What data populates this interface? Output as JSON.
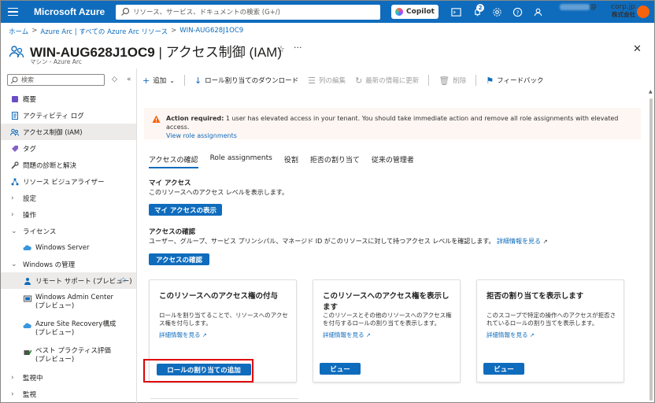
{
  "app": {
    "brand": "Microsoft Azure",
    "search_placeholder": "リソース、サービス、ドキュメントの検索 (G+/)",
    "copilot_label": "Copilot",
    "notification_count": "2",
    "account_email_suffix": "@　　corp.jp",
    "account_org": "株式会社"
  },
  "breadcrumb": [
    "ホーム",
    "Azure Arc | すべての Azure Arc リソース",
    "WIN-AUG628J1OC9"
  ],
  "header": {
    "resource_name": "WIN-AUG628J1OC9",
    "page_name": " | アクセス制御 (IAM)",
    "subtitle": "マシン - Azure Arc"
  },
  "nav": {
    "search_placeholder": "検索",
    "items": [
      {
        "label": "概要",
        "icon": "overview-icon"
      },
      {
        "label": "アクティビティ ログ",
        "icon": "activity-log-icon"
      },
      {
        "label": "アクセス制御 (IAM)",
        "icon": "iam-icon"
      },
      {
        "label": "タグ",
        "icon": "tag-icon"
      },
      {
        "label": "問題の診断と解決",
        "icon": "wrench-icon"
      },
      {
        "label": "リソース ビジュアライザー",
        "icon": "visualizer-icon"
      },
      {
        "label": "設定"
      },
      {
        "label": "操作"
      },
      {
        "label": "ライセンス"
      },
      {
        "label": "Windows Server",
        "icon": "cloud-icon"
      },
      {
        "label": "Windows の管理"
      },
      {
        "label": "リモート サポート (プレビュー)",
        "icon": "remote-support-icon"
      },
      {
        "label": "Windows Admin Center\n(プレビュー)",
        "icon": "admin-center-icon"
      },
      {
        "label": "Azure Site Recovery構成\n(プレビュー)",
        "icon": "site-recovery-icon"
      },
      {
        "label": "ベスト プラクティス評価 (プレビュー)",
        "icon": "best-practice-icon"
      },
      {
        "label": "監視中"
      },
      {
        "label": "監視"
      }
    ]
  },
  "toolbar": {
    "add": "追加",
    "download": "ロール割り当てのダウンロード",
    "edit_columns": "列の編集",
    "refresh": "最新の情報に更新",
    "delete": "削除",
    "feedback": "フィードバック"
  },
  "alert": {
    "bold": "Action required:",
    "text": " 1 user has elevated access in your tenant. You should take immediate action and remove all role assignments with elevated access.",
    "link": "View role assignments"
  },
  "tabs": [
    "アクセスの確認",
    "Role assignments",
    "役割",
    "拒否の割り当て",
    "従来の管理者"
  ],
  "my_access": {
    "title": "マイ アクセス",
    "desc": "このリソースへのアクセス レベルを表示します。",
    "button": "マイ アクセスの表示"
  },
  "check_access": {
    "title": "アクセスの確認",
    "desc": "ユーザー、グループ、サービス プリンシパル、マネージド ID がこのリソースに対して持つアクセス レベルを確認します。",
    "link": "詳細情報を見る",
    "button": "アクセスの確認"
  },
  "cards": [
    {
      "title": "このリソースへのアクセス権の付与",
      "desc": "ロールを割り当てることで、リソースへのアクセス権を付与します。",
      "link": "詳細情報を見る",
      "button": "ロールの割り当ての追加"
    },
    {
      "title": "このリソースへのアクセス権を表示します",
      "desc": "このリソースとその他のリソースへのアクセス権を付与するロールの割り当てを表示します。",
      "link": "詳細情報を見る",
      "button": "ビュー"
    },
    {
      "title": "拒否の割り当てを表示します",
      "desc": "このスコープで特定の操作へのアクセスが拒否されているロールの割り当てを表示します。",
      "link": "詳細情報を見る",
      "button": "ビュー"
    }
  ],
  "colors": {
    "accent": "#0f6cbd",
    "highlight": "#e00000",
    "alert_bg": "#fdf6f3"
  }
}
